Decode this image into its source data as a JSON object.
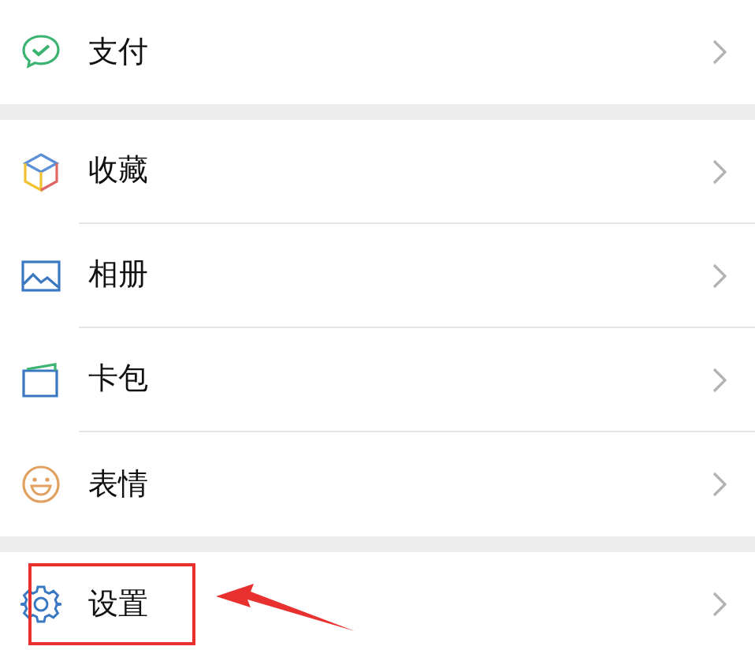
{
  "sections": [
    {
      "items": [
        {
          "kind": "pay",
          "label": "支付",
          "highlighted": false
        }
      ]
    },
    {
      "items": [
        {
          "kind": "favorites",
          "label": "收藏",
          "highlighted": false
        },
        {
          "kind": "album",
          "label": "相册",
          "highlighted": false
        },
        {
          "kind": "cards",
          "label": "卡包",
          "highlighted": false
        },
        {
          "kind": "sticker",
          "label": "表情",
          "highlighted": false
        }
      ]
    },
    {
      "items": [
        {
          "kind": "settings",
          "label": "设置",
          "highlighted": true
        }
      ]
    }
  ]
}
